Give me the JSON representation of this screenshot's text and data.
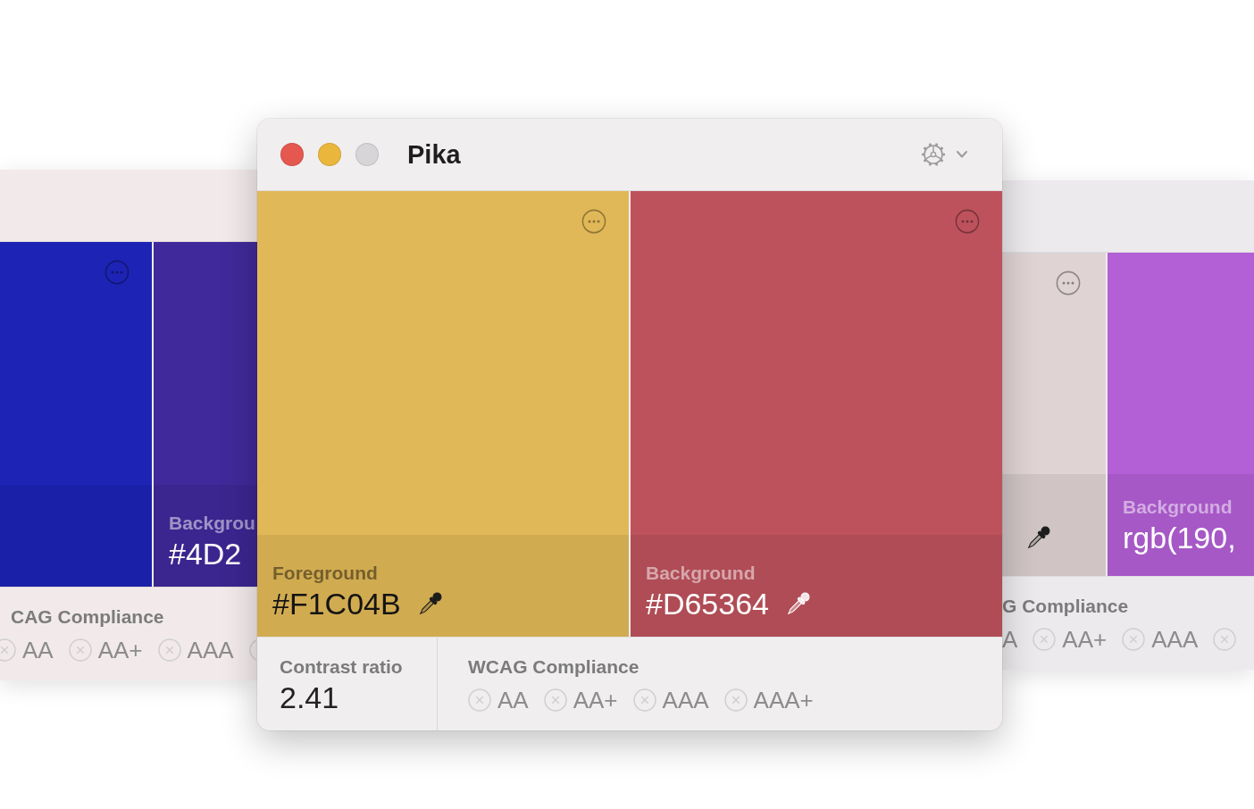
{
  "windows": [
    {
      "swatches": [
        {
          "color": "#1d24b5",
          "menu_button": true
        },
        {
          "color": "#40299a",
          "label": "Backgrou",
          "value": "#4D2"
        }
      ],
      "compliance": {
        "title": "CAG Compliance",
        "levels": [
          {
            "label": "AA",
            "passed": false
          },
          {
            "label": "AA+",
            "passed": false
          },
          {
            "label": "AAA",
            "passed": false
          },
          {
            "passed": false
          }
        ]
      }
    },
    {
      "title": "Pika",
      "traffic_lights": [
        {
          "kind": "close",
          "disabled": false
        },
        {
          "kind": "minimize",
          "disabled": false
        },
        {
          "kind": "zoom",
          "disabled": true
        }
      ],
      "settings_menu": true,
      "swatches": [
        {
          "color": "#e1b857",
          "label": "Foreground",
          "value": "#F1C04B",
          "menu_button": true,
          "eyedropper": true
        },
        {
          "color": "#bd525c",
          "label": "Background",
          "value": "#D65364",
          "menu_button": true,
          "eyedropper": true
        }
      ],
      "contrast": {
        "label": "Contrast ratio",
        "value": "2.41"
      },
      "compliance": {
        "title": "WCAG Compliance",
        "levels": [
          {
            "label": "AA",
            "passed": false
          },
          {
            "label": "AA+",
            "passed": false
          },
          {
            "label": "AAA",
            "passed": false
          },
          {
            "label": "AAA+",
            "passed": false
          }
        ]
      }
    },
    {
      "swatches": [
        {
          "color": "#e0d3d4",
          "menu_button": true,
          "eyedropper": true
        },
        {
          "color": "#b35fd6",
          "label": "Background",
          "value": "rgb(190,"
        }
      ],
      "compliance": {
        "title": "G Compliance",
        "levels": [
          {
            "label": "A"
          },
          {
            "label": "AA+",
            "passed": false
          },
          {
            "label": "AAA",
            "passed": false
          },
          {
            "passed": false
          }
        ]
      }
    }
  ]
}
